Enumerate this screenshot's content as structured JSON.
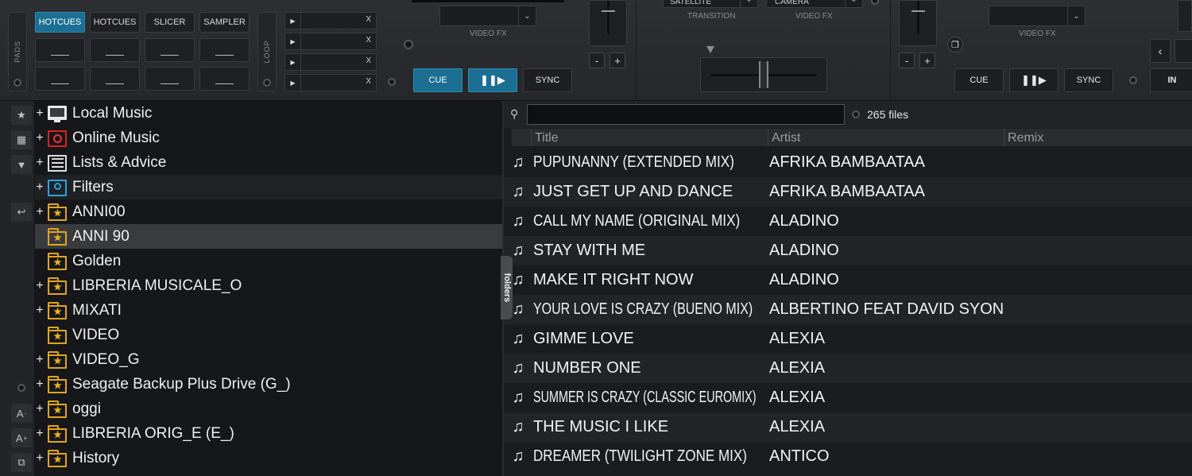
{
  "deck_left": {
    "pads_label": "PADS",
    "pad_tabs": [
      "HOTCUES",
      "HOTCUES",
      "SLICER",
      "SAMPLER"
    ],
    "loop_label": "LOOP",
    "loop_clear": [
      "X",
      "X",
      "X",
      "X"
    ],
    "videofx_label": "VIDEO FX",
    "cue_label": "CUE",
    "sync_label": "SYNC",
    "pitch_minus": "-",
    "pitch_plus": "+"
  },
  "mixer": {
    "transition_value": "SATELLITE",
    "transition_label": "TRANSITION",
    "videofx_value": "CAMERA",
    "videofx_label": "VIDEO FX"
  },
  "deck_right": {
    "videofx_label": "VIDEO FX",
    "cue_label": "CUE",
    "sync_label": "SYNC",
    "pitch_minus": "-",
    "pitch_plus": "+",
    "in_label": "IN"
  },
  "sidebar_icons": [
    "favorite-icon",
    "add-folder-icon",
    "filter-icon",
    "back-icon",
    "record-icon",
    "font-decrease-icon",
    "font-increase-icon",
    "window-icon"
  ],
  "sidebar_text": {
    "font_small": "A",
    "font_large": "A"
  },
  "tree": {
    "items": [
      {
        "label": "Local Music",
        "icon": "computer-icon",
        "expand": "+"
      },
      {
        "label": "Online Music",
        "icon": "globe-icon",
        "expand": "+"
      },
      {
        "label": "Lists & Advice",
        "icon": "list-icon",
        "expand": "+"
      },
      {
        "label": "Filters",
        "icon": "filter-folder-icon",
        "expand": "+"
      },
      {
        "label": "ANNI00",
        "icon": "star-folder-icon",
        "expand": "+"
      },
      {
        "label": "ANNI 90",
        "icon": "star-folder-icon",
        "expand": ""
      },
      {
        "label": "Golden",
        "icon": "star-folder-icon",
        "expand": ""
      },
      {
        "label": "LIBRERIA MUSICALE_O",
        "icon": "star-folder-icon",
        "expand": "+"
      },
      {
        "label": "MIXATI",
        "icon": "star-folder-icon",
        "expand": "+"
      },
      {
        "label": "VIDEO",
        "icon": "star-folder-icon",
        "expand": ""
      },
      {
        "label": "VIDEO_G",
        "icon": "star-folder-icon",
        "expand": "+"
      },
      {
        "label": "Seagate Backup Plus Drive (G_)",
        "icon": "star-folder-icon",
        "expand": "+"
      },
      {
        "label": "oggi",
        "icon": "star-folder-icon",
        "expand": "+"
      },
      {
        "label": "LIBRERIA ORIG_E (E_)",
        "icon": "star-folder-icon",
        "expand": "+"
      },
      {
        "label": "History",
        "icon": "star-folder-icon",
        "expand": "+"
      }
    ]
  },
  "folders_tab": "folders",
  "browser": {
    "search_value": "",
    "file_count": "265 files",
    "columns": [
      "Title",
      "Artist",
      "Remix"
    ],
    "tracks": [
      {
        "title": "PUPUNANNY (EXTENDED MIX)",
        "artist": "AFRIKA BAMBAATAA"
      },
      {
        "title": "JUST GET UP AND DANCE",
        "artist": "AFRIKA BAMBAATAA"
      },
      {
        "title": "CALL MY NAME (ORIGINAL MIX)",
        "artist": "ALADINO"
      },
      {
        "title": "STAY WITH ME",
        "artist": "ALADINO"
      },
      {
        "title": "MAKE IT RIGHT NOW",
        "artist": "ALADINO"
      },
      {
        "title": "YOUR LOVE IS CRAZY (BUENO MIX)",
        "artist": "ALBERTINO FEAT DAVID SYON"
      },
      {
        "title": "GIMME LOVE",
        "artist": "ALEXIA"
      },
      {
        "title": "NUMBER ONE",
        "artist": "ALEXIA"
      },
      {
        "title": "SUMMER IS CRAZY (CLASSIC EUROMIX)",
        "artist": "ALEXIA"
      },
      {
        "title": "THE MUSIC I LIKE",
        "artist": "ALEXIA"
      },
      {
        "title": "DREAMER (TWILIGHT ZONE MIX)",
        "artist": "ANTICO"
      }
    ]
  },
  "colors": {
    "accent_blue": "#1c6f92",
    "folder_yellow": "#e2a51e"
  }
}
